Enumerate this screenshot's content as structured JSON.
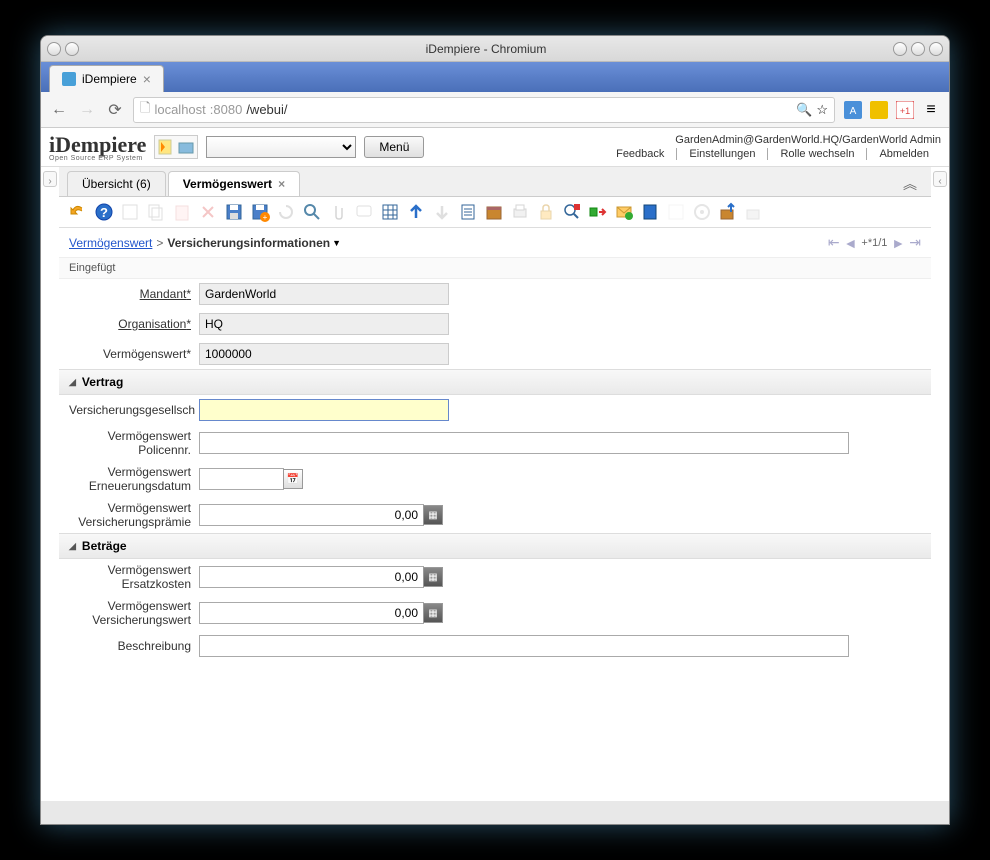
{
  "window": {
    "title": "iDempiere - Chromium"
  },
  "browser": {
    "tab_title": "iDempiere",
    "url_host": "localhost",
    "url_port": ":8080",
    "url_path": "/webui/"
  },
  "header": {
    "logo": "iDempiere",
    "logo_sub": "Open Source ERP System",
    "menu_btn": "Menü",
    "user_context": "GardenAdmin@GardenWorld.HQ/GardenWorld Admin",
    "links": {
      "feedback": "Feedback",
      "settings": "Einstellungen",
      "switch_role": "Rolle wechseln",
      "logout": "Abmelden"
    }
  },
  "tabs": {
    "overview": "Übersicht (6)",
    "current": "Vermögenswert"
  },
  "breadcrumb": {
    "root": "Vermögenswert",
    "current": "Versicherungsinformationen",
    "record_pos": "+*1/1"
  },
  "status": "Eingefügt",
  "form": {
    "mandant_label": "Mandant",
    "mandant_value": "GardenWorld",
    "org_label": "Organisation",
    "org_value": "HQ",
    "asset_label": "Vermögenswert",
    "asset_value": "1000000"
  },
  "sections": {
    "vertrag": {
      "title": "Vertrag",
      "company_label": "Versicherungsgesellsch",
      "company_value": "",
      "policy_label": "Vermögenswert Policennr.",
      "policy_value": "",
      "renewal_label": "Vermögenswert Erneuerungsdatum",
      "renewal_value": "",
      "premium_label": "Vermögenswert Versicherungsprämie",
      "premium_value": "0,00"
    },
    "betraege": {
      "title": "Beträge",
      "replace_label": "Vermögenswert Ersatzkosten",
      "replace_value": "0,00",
      "insured_label": "Vermögenswert Versicherungswert",
      "insured_value": "0,00",
      "desc_label": "Beschreibung",
      "desc_value": ""
    }
  }
}
